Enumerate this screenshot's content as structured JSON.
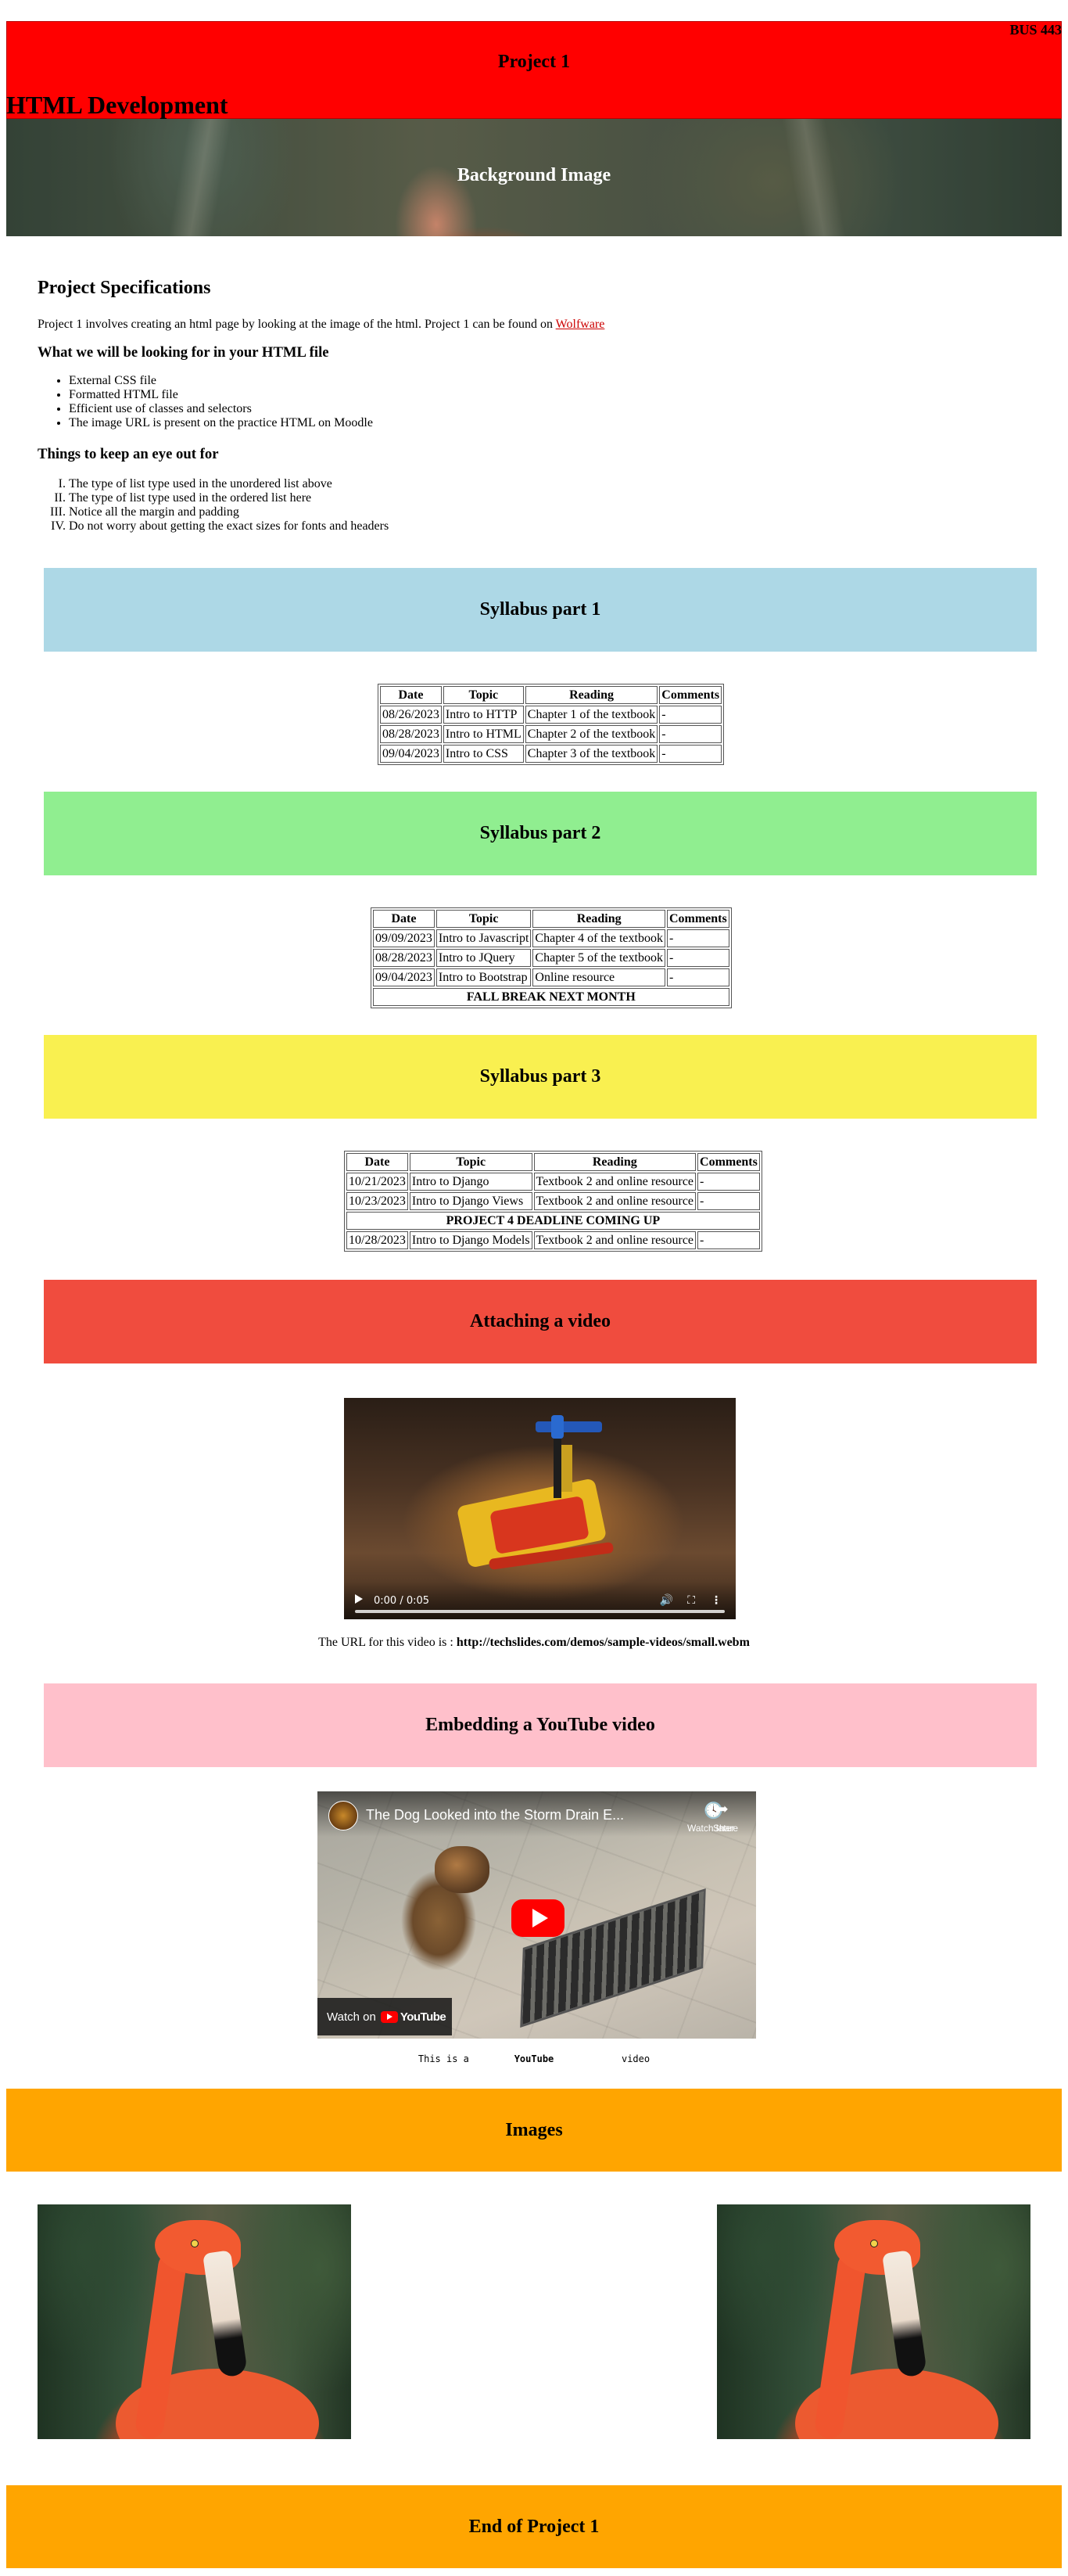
{
  "header": {
    "course_code": "BUS 443",
    "project_label": "Project 1",
    "site_title": "HTML Development",
    "hero_label": "Background Image",
    "hero_colors": {
      "red_banner": "#ff0000"
    }
  },
  "spec": {
    "title": "Project Specifications",
    "intro_text": "Project 1 involves creating an html page by looking at the image of the html. Project 1 can be found on",
    "intro_link": "Wolfware",
    "look_title": "What we will be looking for in your HTML file",
    "look_items": [
      "External CSS file",
      "Formatted HTML file",
      "Efficient use of classes and selectors",
      "The image URL is present on the practice HTML on Moodle"
    ],
    "eye_title": "Things to keep an eye out for",
    "eye_items": [
      "The type of list type used in the unordered list above",
      "The type of list type used in the ordered list here",
      "Notice all the margin and padding",
      "Do not worry about getting the exact sizes for fonts and headers"
    ]
  },
  "sections": {
    "s1": {
      "title": "Syllabus part 1",
      "color": "#add8e6"
    },
    "s2": {
      "title": "Syllabus part 2",
      "color": "#90ee90"
    },
    "s3": {
      "title": "Syllabus part 3",
      "color": "#f9f050"
    },
    "video": {
      "title": "Attaching a video",
      "color": "#f04c3e"
    },
    "youtube": {
      "title": "Embedding a YouTube video",
      "color": "#ffc0cb"
    },
    "images": {
      "title": "Images",
      "color": "#ffa500"
    },
    "end": {
      "title": "End of Project 1",
      "color": "#ffa500"
    }
  },
  "table_headers": {
    "date": "Date",
    "topic": "Topic",
    "reading": "Reading",
    "comments": "Comments"
  },
  "syllabus1": [
    {
      "date": "08/26/2023",
      "topic": "Intro to HTTP",
      "reading": "Chapter 1 of the textbook",
      "comments": "-"
    },
    {
      "date": "08/28/2023",
      "topic": "Intro to HTML",
      "reading": "Chapter 2 of the textbook",
      "comments": "-"
    },
    {
      "date": "09/04/2023",
      "topic": "Intro to CSS",
      "reading": "Chapter 3 of the textbook",
      "comments": "-"
    }
  ],
  "syllabus2": [
    {
      "date": "09/09/2023",
      "topic": "Intro to Javascript",
      "reading": "Chapter 4 of the textbook",
      "comments": "-"
    },
    {
      "date": "08/28/2023",
      "topic": "Intro to JQuery",
      "reading": "Chapter 5 of the textbook",
      "comments": "-"
    },
    {
      "date": "09/04/2023",
      "topic": "Intro to Bootstrap",
      "reading": "Online resource",
      "comments": "-"
    }
  ],
  "syllabus2_note": "FALL BREAK NEXT MONTH",
  "syllabus3": [
    {
      "date": "10/21/2023",
      "topic": "Intro to Django",
      "reading": "Textbook 2 and online resource",
      "comments": "-"
    },
    {
      "date": "10/23/2023",
      "topic": "Intro to Django Views",
      "reading": "Textbook 2 and online resource",
      "comments": "-"
    },
    {
      "date": "10/28/2023",
      "topic": "Intro to Django Models",
      "reading": "Textbook 2 and online resource",
      "comments": "-"
    }
  ],
  "syllabus3_note": "PROJECT 4 DEADLINE COMING UP",
  "video": {
    "time": "0:00 / 0:05",
    "progress": 0.0,
    "caption_prefix": "The URL for this video is : ",
    "caption_url": "http://techslides.com/demos/sample-videos/small.webm",
    "icons": [
      "play-icon",
      "volume-icon",
      "fullscreen-icon",
      "more-options-icon"
    ]
  },
  "youtube": {
    "title": "The Dog Looked into the Storm Drain E...",
    "watch_later": "Watch later",
    "share": "Share",
    "watch_on": "Watch on",
    "brand": "YouTube",
    "caption_a": "This is a",
    "caption_b": "YouTube",
    "caption_c": "video"
  }
}
